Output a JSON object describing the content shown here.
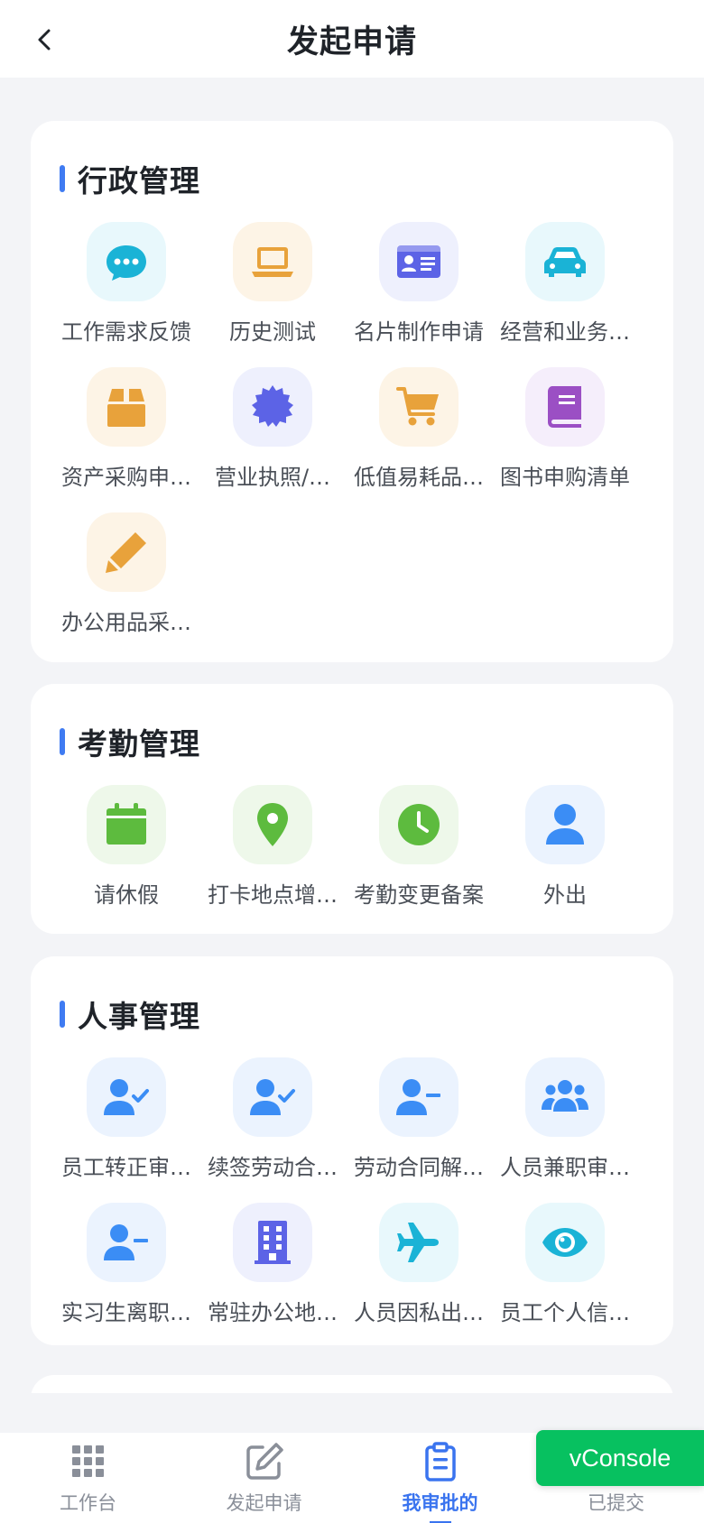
{
  "header": {
    "title": "发起申请"
  },
  "sections": [
    {
      "title": "行政管理",
      "items": [
        {
          "label": "工作需求反馈",
          "icon": "chat-bubble-icon",
          "color": "#1ab3d6",
          "bg": "#e8f8fc"
        },
        {
          "label": "历史测试",
          "icon": "laptop-icon",
          "color": "#e8a23b",
          "bg": "#fdf4e6"
        },
        {
          "label": "名片制作申请",
          "icon": "id-card-icon",
          "color": "#5c63e6",
          "bg": "#eef0fd"
        },
        {
          "label": "经营和业务…",
          "icon": "car-icon",
          "color": "#1ab3d6",
          "bg": "#e8f8fc"
        },
        {
          "label": "资产采购申…",
          "icon": "box-icon",
          "color": "#e8a23b",
          "bg": "#fdf4e6"
        },
        {
          "label": "营业执照/…",
          "icon": "certificate-icon",
          "color": "#5c63e6",
          "bg": "#eef0fd"
        },
        {
          "label": "低值易耗品…",
          "icon": "cart-icon",
          "color": "#e8a23b",
          "bg": "#fdf4e6"
        },
        {
          "label": "图书申购清单",
          "icon": "book-icon",
          "color": "#9b4fc4",
          "bg": "#f5eefb"
        },
        {
          "label": "办公用品采…",
          "icon": "pencil-icon",
          "color": "#e8a23b",
          "bg": "#fdf4e6"
        }
      ]
    },
    {
      "title": "考勤管理",
      "items": [
        {
          "label": "请休假",
          "icon": "calendar-icon",
          "color": "#5dbb3e",
          "bg": "#eef8ea"
        },
        {
          "label": "打卡地点增…",
          "icon": "location-pin-icon",
          "color": "#5dbb3e",
          "bg": "#eef8ea"
        },
        {
          "label": "考勤变更备案",
          "icon": "clock-icon",
          "color": "#5dbb3e",
          "bg": "#eef8ea"
        },
        {
          "label": "外出",
          "icon": "user-icon",
          "color": "#3b8df5",
          "bg": "#ebf3fe"
        }
      ]
    },
    {
      "title": "人事管理",
      "items": [
        {
          "label": "员工转正审…",
          "icon": "user-check-icon",
          "color": "#3b8df5",
          "bg": "#ebf3fe"
        },
        {
          "label": "续签劳动合…",
          "icon": "user-check-icon",
          "color": "#3b8df5",
          "bg": "#ebf3fe"
        },
        {
          "label": "劳动合同解…",
          "icon": "user-minus-icon",
          "color": "#3b8df5",
          "bg": "#ebf3fe"
        },
        {
          "label": "人员兼职审…",
          "icon": "users-icon",
          "color": "#3b8df5",
          "bg": "#ebf3fe"
        },
        {
          "label": "实习生离职…",
          "icon": "user-minus-icon",
          "color": "#3b8df5",
          "bg": "#ebf3fe"
        },
        {
          "label": "常驻办公地…",
          "icon": "building-icon",
          "color": "#5c63e6",
          "bg": "#eef0fd"
        },
        {
          "label": "人员因私出…",
          "icon": "airplane-icon",
          "color": "#1ab3d6",
          "bg": "#e8f8fc"
        },
        {
          "label": "员工个人信…",
          "icon": "eye-icon",
          "color": "#1ab3d6",
          "bg": "#e8f8fc"
        }
      ]
    }
  ],
  "tabbar": {
    "tabs": [
      {
        "label": "工作台",
        "icon": "grid-icon"
      },
      {
        "label": "发起申请",
        "icon": "edit-icon"
      },
      {
        "label": "我审批的",
        "icon": "clipboard-icon",
        "active": true
      },
      {
        "label": "已提交",
        "icon": "submitted-icon"
      }
    ],
    "active_color": "#3a74ef",
    "inactive_color": "#8a8f99"
  },
  "vconsole": {
    "label": "vConsole",
    "color": "#07c160"
  }
}
